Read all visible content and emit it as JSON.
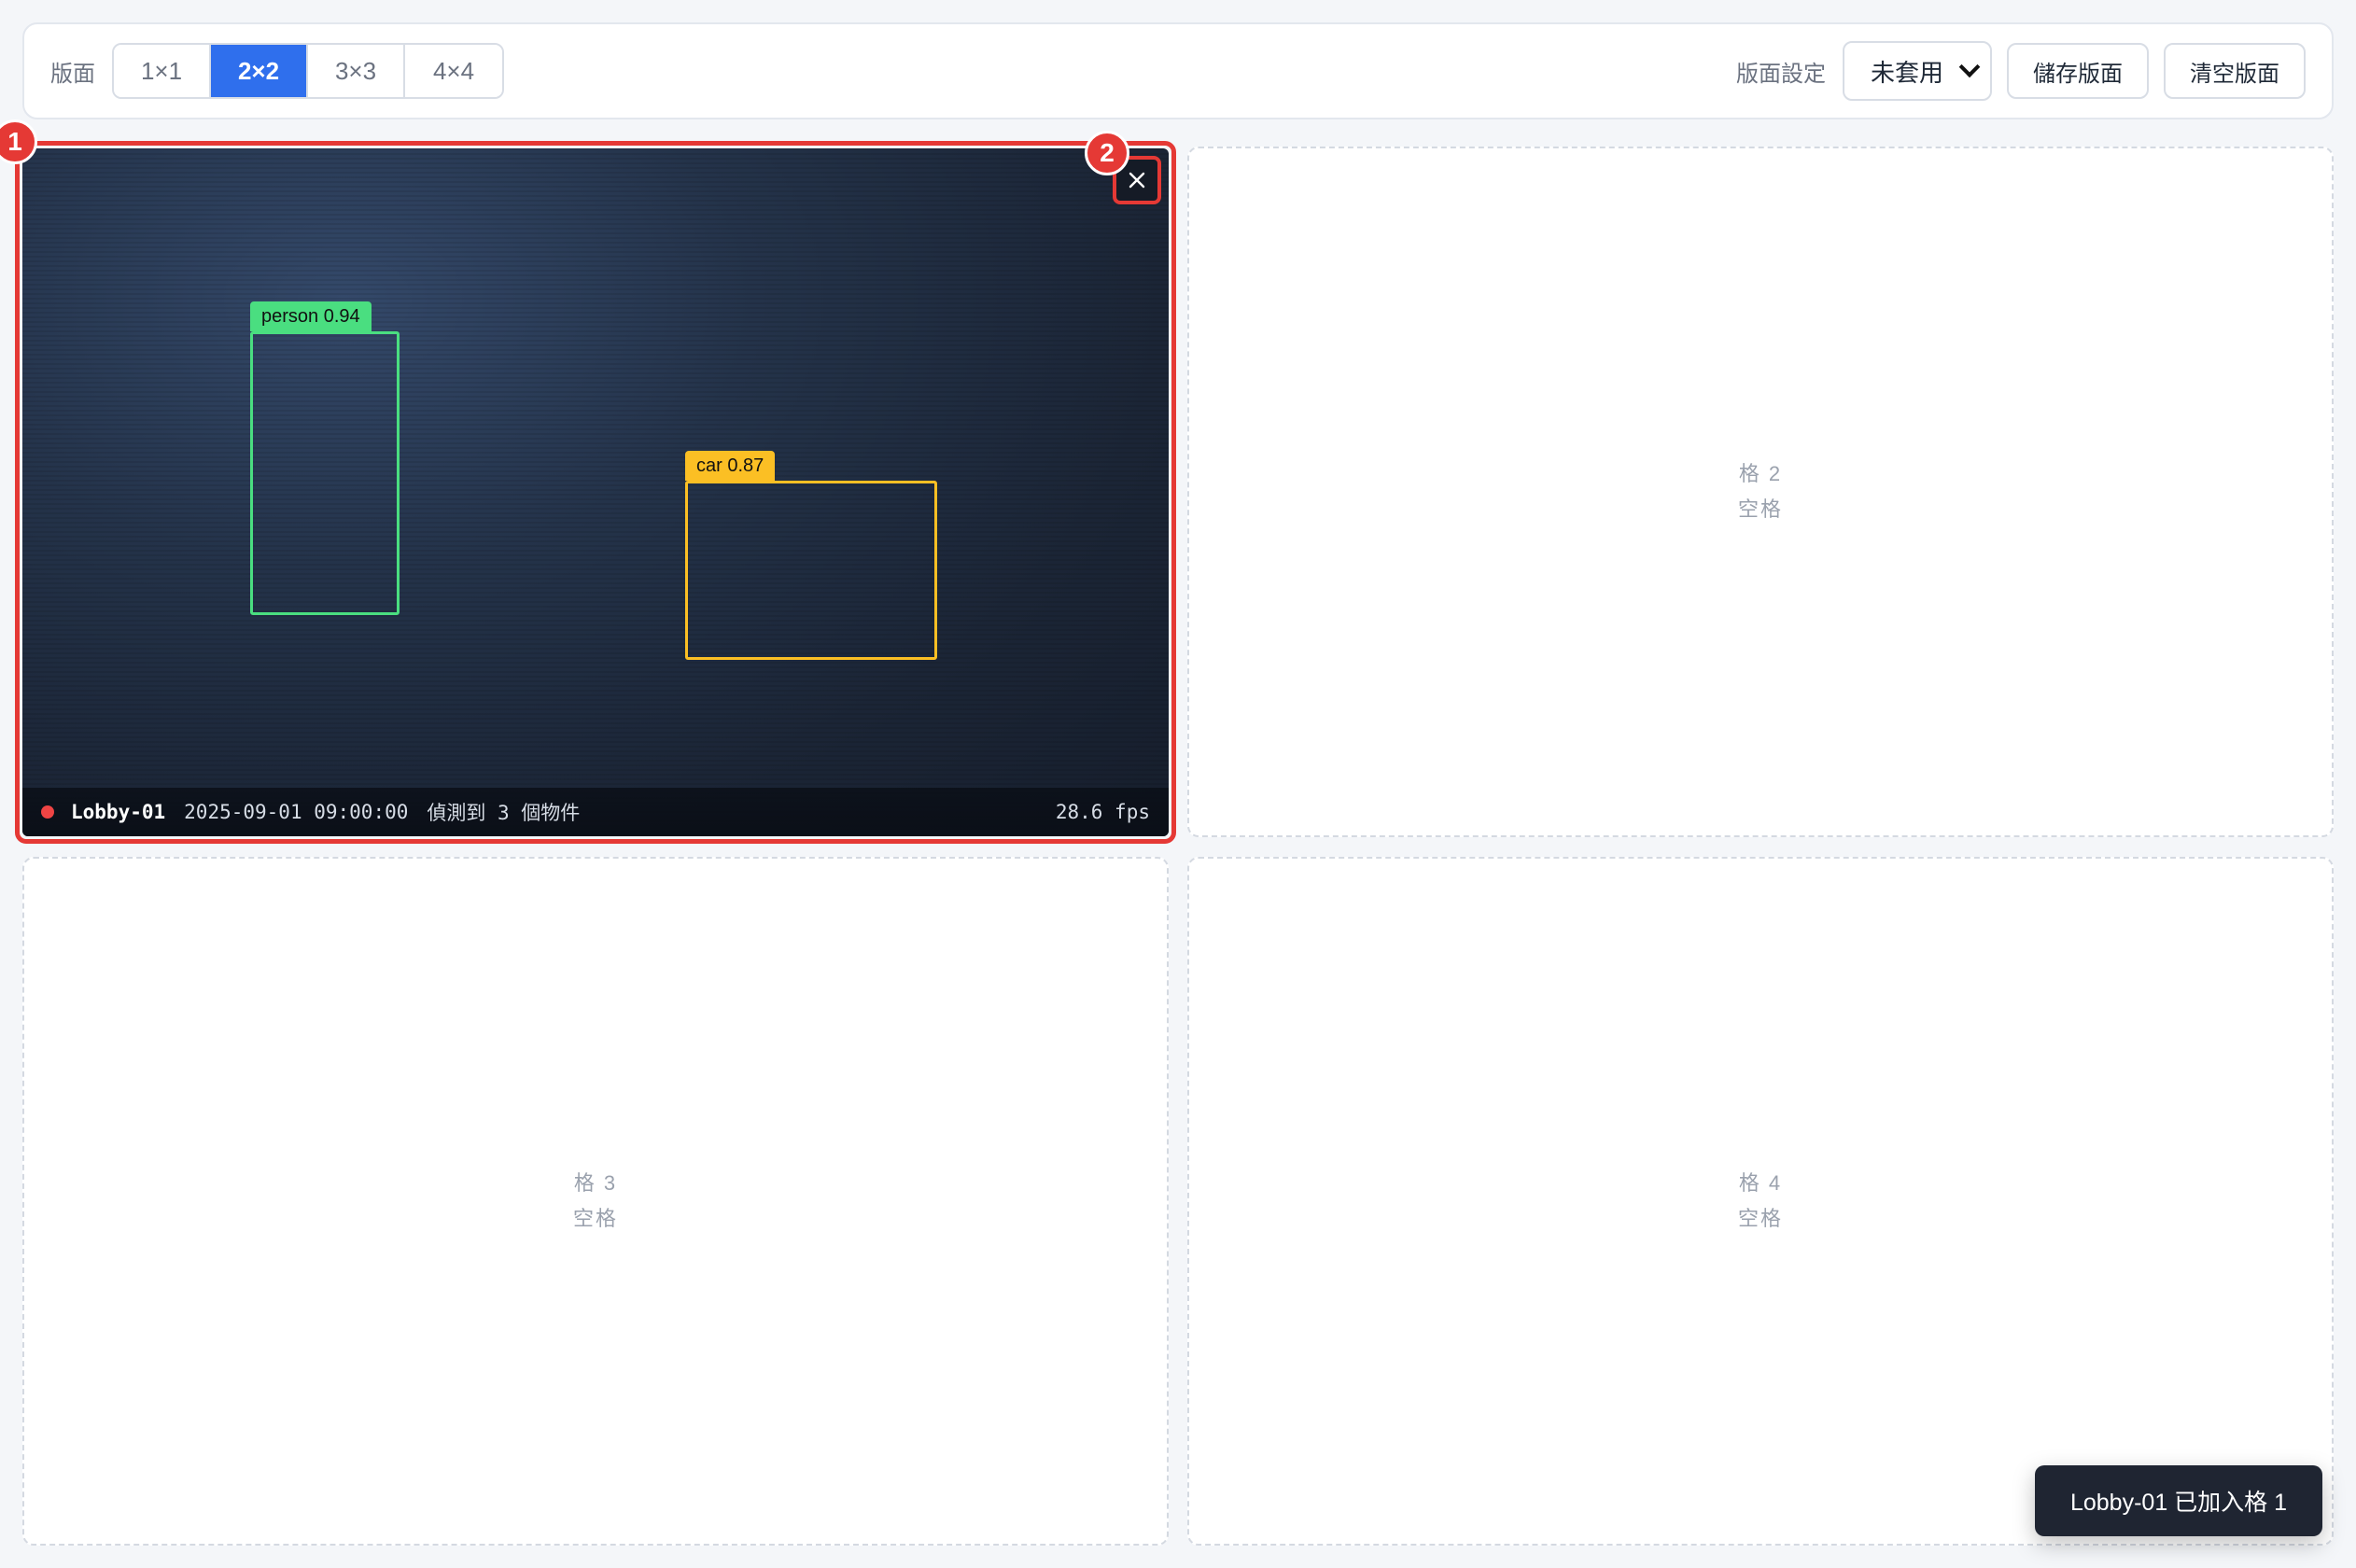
{
  "toolbar": {
    "layout_label": "版面",
    "layout_options": [
      "1×1",
      "2×2",
      "3×3",
      "4×4"
    ],
    "active_layout": "2×2",
    "preset_label": "版面設定",
    "preset_value": "未套用",
    "save_label": "儲存版面",
    "clear_label": "清空版面"
  },
  "cells": [
    {
      "index": 1,
      "camera": "Lobby-01",
      "timestamp": "2025-09-01 09:00:00",
      "detection_text": "偵測到 3 個物件",
      "fps": "28.6 fps",
      "detections": [
        {
          "label": "person 0.94",
          "color": "#4ade80"
        },
        {
          "label": "car 0.87",
          "color": "#fbbf24"
        }
      ],
      "close_icon": "close-icon"
    },
    {
      "index": 2,
      "title": "格 2",
      "status": "空格"
    },
    {
      "index": 3,
      "title": "格 3",
      "status": "空格"
    },
    {
      "index": 4,
      "title": "格 4",
      "status": "空格"
    }
  ],
  "annotations": {
    "badge_1": "1",
    "badge_2": "2"
  },
  "toast": {
    "message": "Lobby-01 已加入格 1"
  },
  "colors": {
    "accent": "#2f6fed",
    "highlight": "#e53935",
    "recording": "#ef4444"
  }
}
